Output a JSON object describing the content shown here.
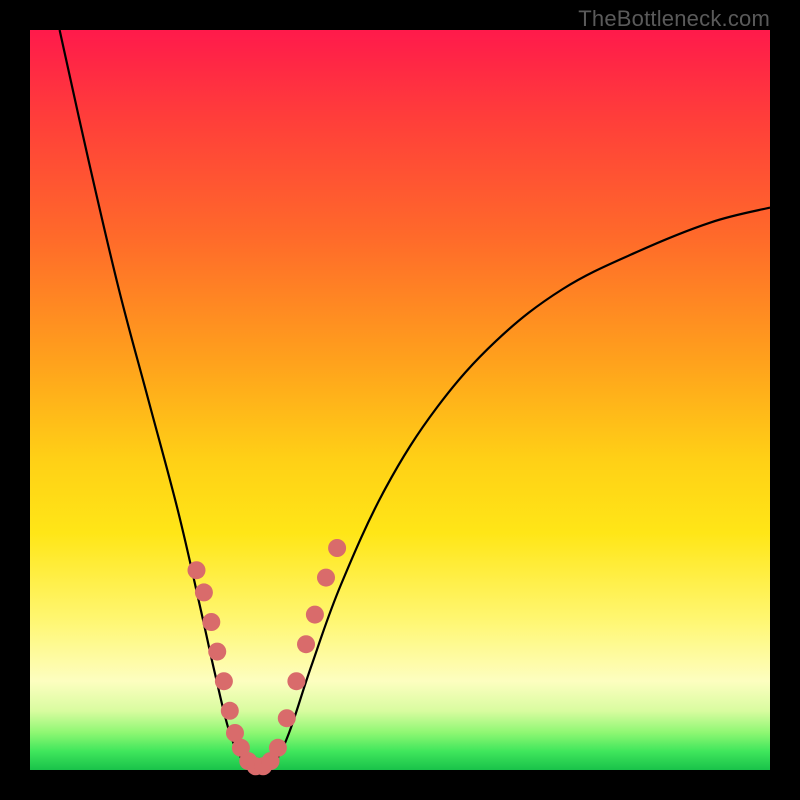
{
  "watermark": "TheBottleneck.com",
  "chart_data": {
    "type": "line",
    "title": "",
    "xlabel": "",
    "ylabel": "",
    "xlim": [
      0,
      100
    ],
    "ylim": [
      0,
      100
    ],
    "background_gradient": {
      "top": "#ff1a4b",
      "upper_mid": "#ffa21c",
      "mid": "#ffe617",
      "lower_mid": "#d9fca0",
      "bottom": "#19c24a"
    },
    "series": [
      {
        "name": "bottleneck-curve",
        "color": "#000000",
        "points": [
          {
            "x": 4,
            "y": 100
          },
          {
            "x": 8,
            "y": 82
          },
          {
            "x": 12,
            "y": 65
          },
          {
            "x": 16,
            "y": 50
          },
          {
            "x": 20,
            "y": 35
          },
          {
            "x": 23,
            "y": 22
          },
          {
            "x": 25,
            "y": 13
          },
          {
            "x": 27,
            "y": 5
          },
          {
            "x": 29,
            "y": 1
          },
          {
            "x": 31,
            "y": 0
          },
          {
            "x": 33,
            "y": 1
          },
          {
            "x": 35,
            "y": 5
          },
          {
            "x": 38,
            "y": 14
          },
          {
            "x": 42,
            "y": 25
          },
          {
            "x": 48,
            "y": 38
          },
          {
            "x": 55,
            "y": 49
          },
          {
            "x": 63,
            "y": 58
          },
          {
            "x": 72,
            "y": 65
          },
          {
            "x": 82,
            "y": 70
          },
          {
            "x": 92,
            "y": 74
          },
          {
            "x": 100,
            "y": 76
          }
        ]
      }
    ],
    "markers": {
      "name": "highlighted-points",
      "color": "#d96b6b",
      "points": [
        {
          "x": 22.5,
          "y": 27
        },
        {
          "x": 23.5,
          "y": 24
        },
        {
          "x": 24.5,
          "y": 20
        },
        {
          "x": 25.3,
          "y": 16
        },
        {
          "x": 26.2,
          "y": 12
        },
        {
          "x": 27.0,
          "y": 8
        },
        {
          "x": 27.7,
          "y": 5
        },
        {
          "x": 28.5,
          "y": 3
        },
        {
          "x": 29.5,
          "y": 1.2
        },
        {
          "x": 30.5,
          "y": 0.5
        },
        {
          "x": 31.5,
          "y": 0.5
        },
        {
          "x": 32.5,
          "y": 1.2
        },
        {
          "x": 33.5,
          "y": 3
        },
        {
          "x": 34.7,
          "y": 7
        },
        {
          "x": 36.0,
          "y": 12
        },
        {
          "x": 37.3,
          "y": 17
        },
        {
          "x": 38.5,
          "y": 21
        },
        {
          "x": 40.0,
          "y": 26
        },
        {
          "x": 41.5,
          "y": 30
        }
      ]
    }
  }
}
